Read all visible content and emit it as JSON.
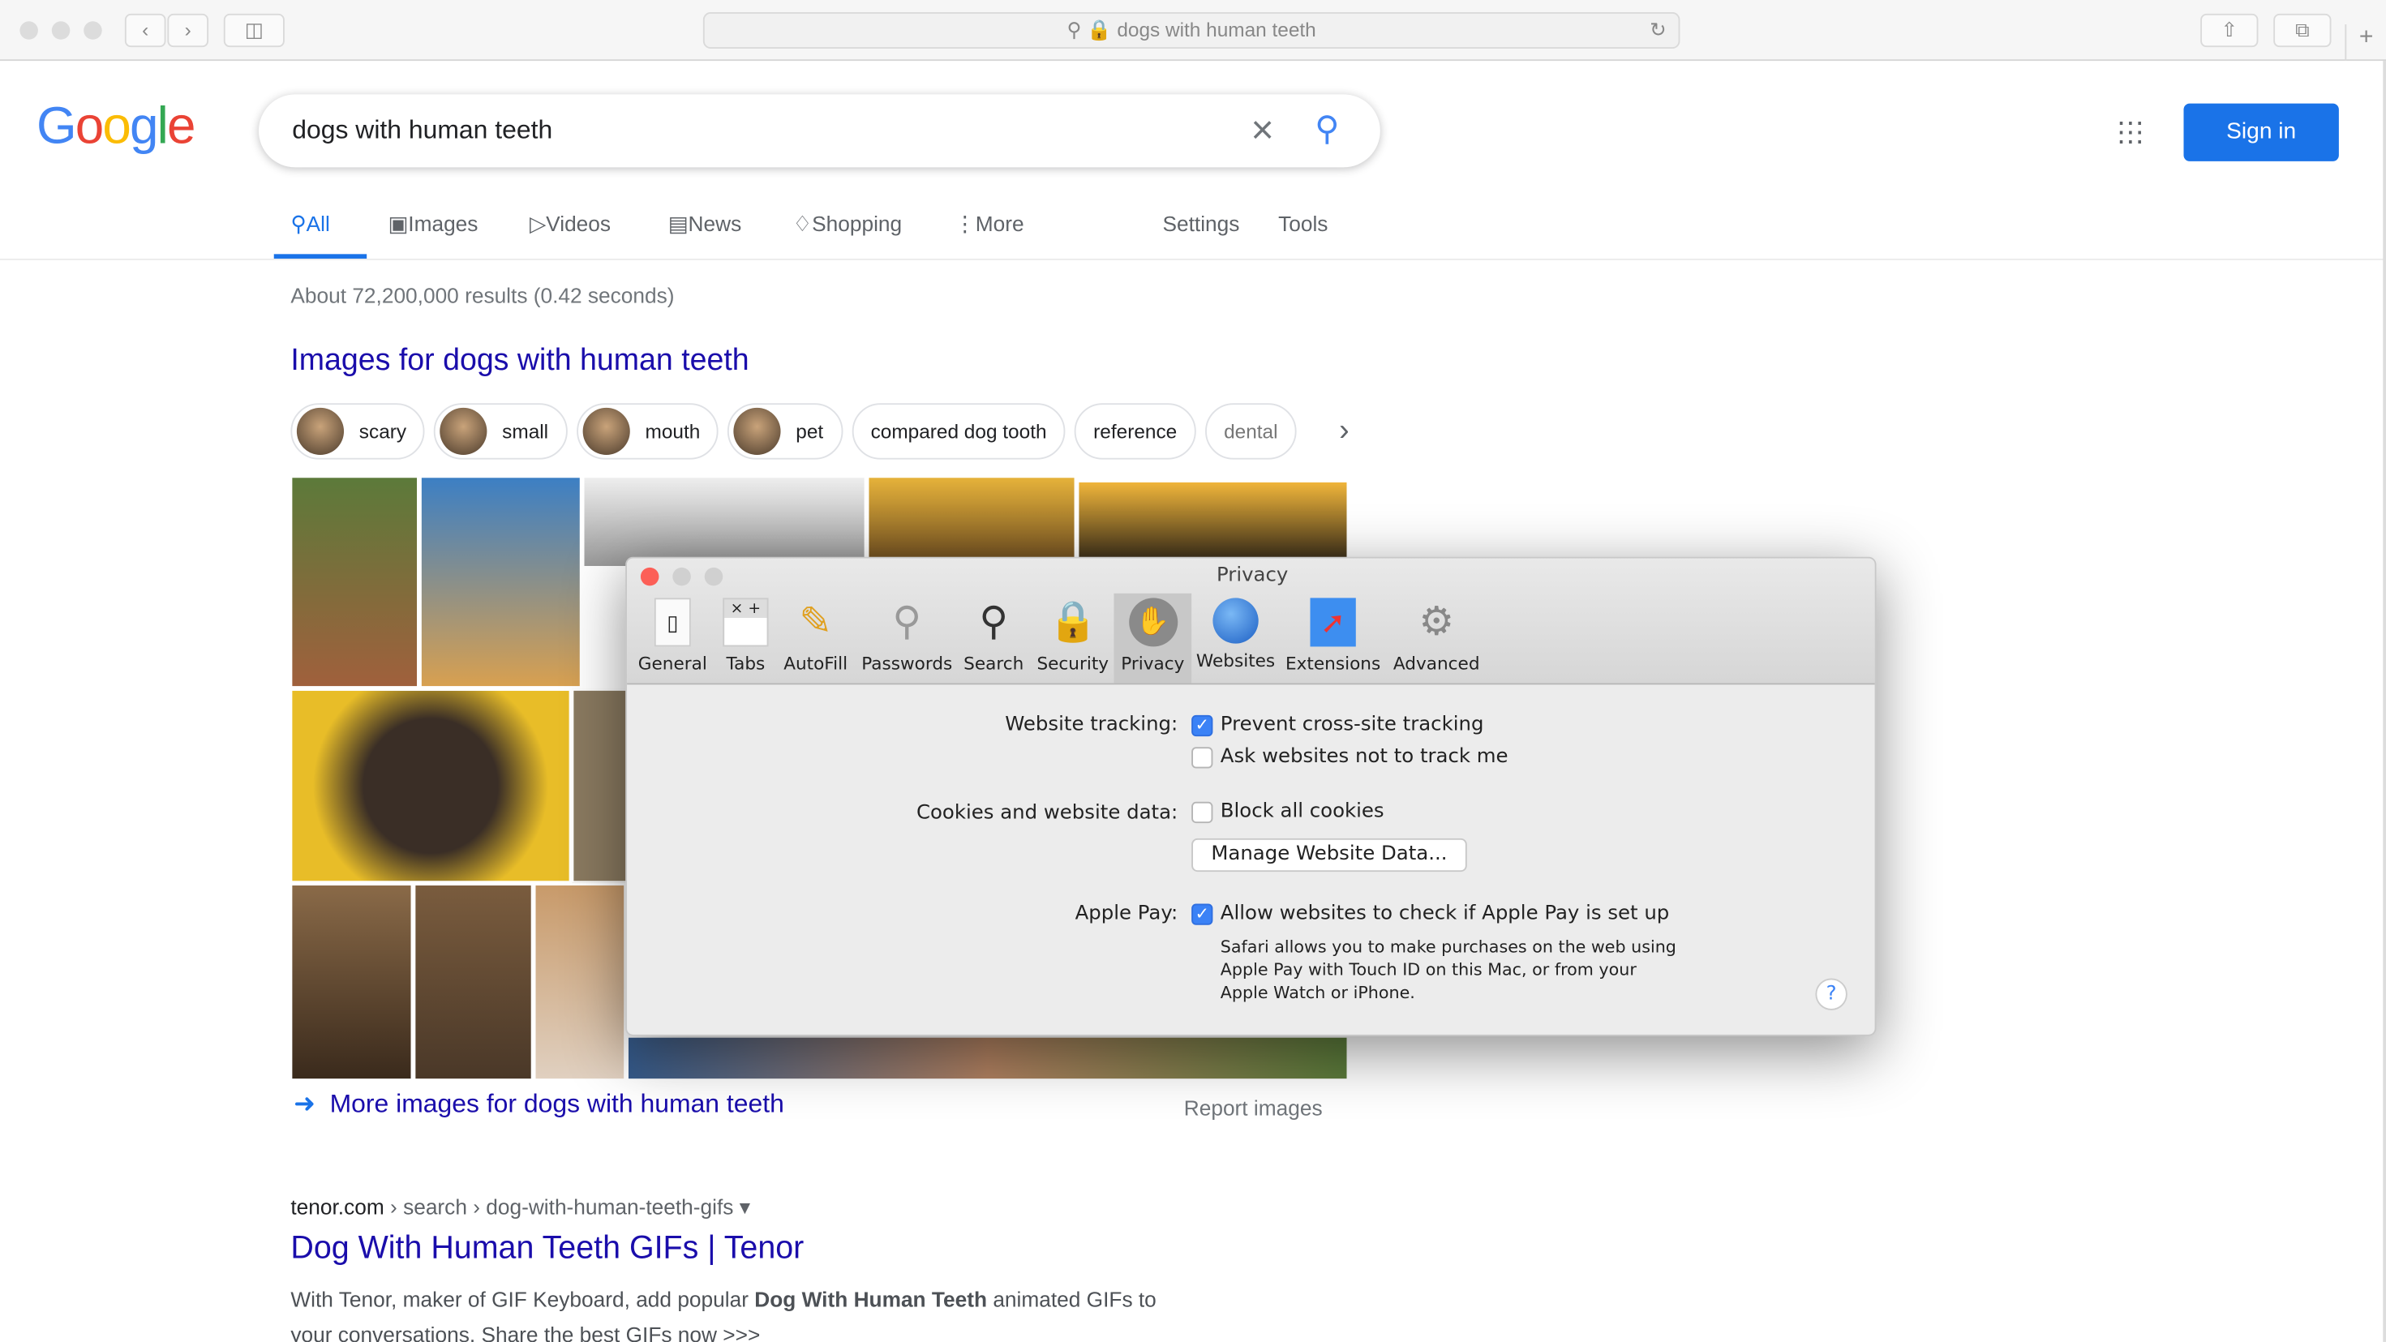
{
  "browser": {
    "url": "dogs with human teeth",
    "new_tab": "+"
  },
  "google": {
    "logo": "Google",
    "query": "dogs with human teeth",
    "sign_in": "Sign in",
    "tabs": [
      "All",
      "Images",
      "Videos",
      "News",
      "Shopping",
      "More"
    ],
    "settings": "Settings",
    "tools": "Tools",
    "stats": "About 72,200,000 results (0.42 seconds)",
    "images_heading": "Images for dogs with human teeth",
    "chips": [
      "scary",
      "small",
      "mouth",
      "pet",
      "compared dog tooth",
      "reference",
      "dental"
    ],
    "more_images": "More images for dogs with human teeth",
    "report_images": "Report images",
    "result": {
      "cite_domain": "tenor.com",
      "cite_path": " › search › dog-with-human-teeth-gifs",
      "title": "Dog With Human Teeth GIFs | Tenor",
      "snippet_1": "With Tenor, maker of GIF Keyboard, add popular ",
      "snippet_bold": "Dog With Human Teeth",
      "snippet_2": " animated GIFs to",
      "snippet_line2": "your conversations. Share the best GIFs now >>>"
    },
    "accent": "#1a73e8"
  },
  "prefs": {
    "title": "Privacy",
    "tabs": [
      "General",
      "Tabs",
      "AutoFill",
      "Passwords",
      "Search",
      "Security",
      "Privacy",
      "Websites",
      "Extensions",
      "Advanced"
    ],
    "selected": "Privacy",
    "tracking_label": "Website tracking:",
    "prevent": "Prevent cross-site tracking",
    "prevent_checked": true,
    "ask": "Ask websites not to track me",
    "ask_checked": false,
    "cookies_label": "Cookies and website data:",
    "block": "Block all cookies",
    "block_checked": false,
    "manage": "Manage Website Data...",
    "applepay_label": "Apple Pay:",
    "applepay": "Allow websites to check if Apple Pay is set up",
    "applepay_checked": true,
    "applepay_note_1": "Safari allows you to make purchases on the web using",
    "applepay_note_2": "Apple Pay with Touch ID on this Mac, or from your",
    "applepay_note_3": "Apple Watch or iPhone.",
    "help": "?"
  }
}
